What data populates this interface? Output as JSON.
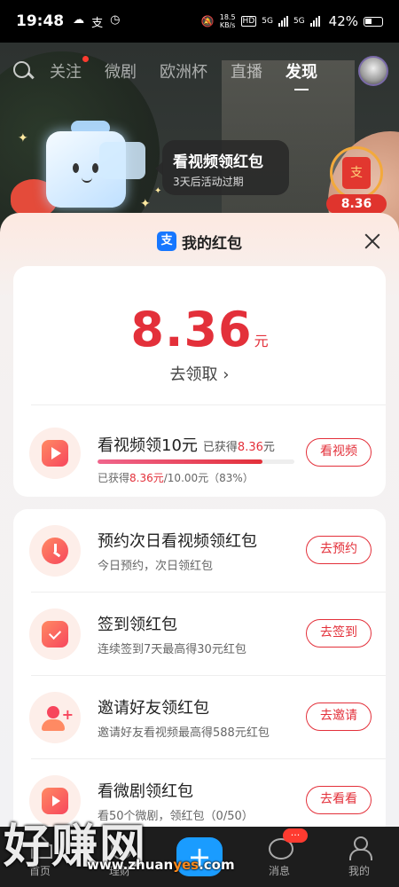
{
  "status_bar": {
    "time": "19:48",
    "left_icons": [
      "cloud-icon",
      "alipay-icon",
      "clock-icon"
    ],
    "net_speed": "18.5",
    "net_unit": "KB/s",
    "hd_label": "HD",
    "network_1": "5G",
    "network_2": "5G",
    "battery_percent": "42%"
  },
  "top_nav": {
    "tabs": [
      "关注",
      "微剧",
      "欧洲杯",
      "直播",
      "发现"
    ],
    "active_tab": "发现"
  },
  "promo": {
    "title": "看视频领红包",
    "subtitle": "3天后活动过期",
    "side_badge_amount": "8.36",
    "side_badge_glyph": "支"
  },
  "sheet": {
    "logo_glyph": "支",
    "title": "我的红包",
    "balance": {
      "amount": "8.36",
      "unit": "元",
      "claim_label": "去领取 ›"
    },
    "video_task": {
      "title": "看视频领10元",
      "earned_prefix": "已获得",
      "earned_amount": "8.36",
      "earned_unit": "元",
      "progress_prefix": "已获得",
      "progress_earned": "8.36元",
      "progress_total": "/10.00元（83%）",
      "progress_fraction": 0.836,
      "button": "看视频"
    },
    "tasks": [
      {
        "title": "预约次日看视频领红包",
        "subtitle": "今日预约，次日领红包",
        "button": "去预约",
        "icon": "clock-icon"
      },
      {
        "title": "签到领红包",
        "subtitle": "连续签到7天最高得30元红包",
        "button": "去签到",
        "icon": "calendar-check-icon"
      },
      {
        "title": "邀请好友领红包",
        "subtitle": "邀请好友看视频最高得588元红包",
        "button": "去邀请",
        "icon": "invite-user-icon"
      },
      {
        "title": "看微剧领红包",
        "subtitle": "看50个微剧，领红包（0/50）",
        "button": "去看看",
        "icon": "tv-play-icon"
      }
    ]
  },
  "bottom_nav": {
    "items": [
      "首页",
      "理财",
      "",
      "消息",
      "我的"
    ],
    "message_badge": "···"
  },
  "watermark": {
    "text": "好赚网",
    "url_prefix": "www.zhuan",
    "url_highlight": "yes",
    "url_suffix": ".com"
  }
}
